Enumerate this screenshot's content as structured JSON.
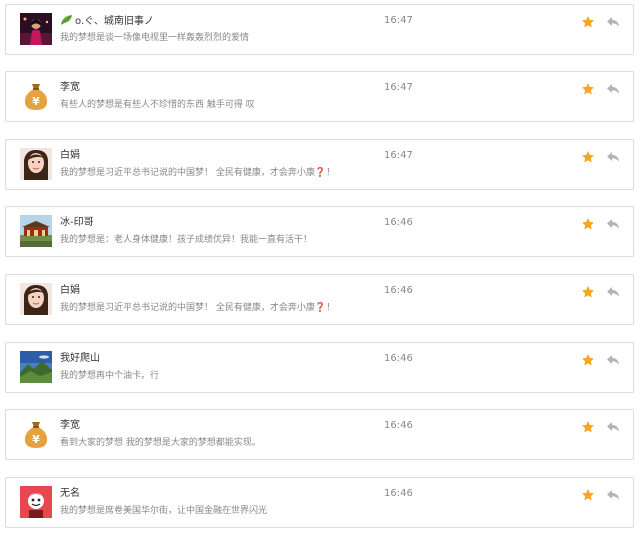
{
  "colors": {
    "star": "#f6a623",
    "reply": "#b4b4b4",
    "name": "#333333",
    "text": "#888888",
    "border": "#dcdcdc",
    "question_mark": "#d0241c"
  },
  "posts": [
    {
      "avatar": "night-portrait-avatar",
      "leaf_icon": true,
      "name": "o.ぐ、城南旧事ノ",
      "text": "我的梦想是谈一场像电视里一样轰轰烈烈的爱情",
      "suffix": "",
      "time": "16:47"
    },
    {
      "avatar": "money-bag-avatar",
      "leaf_icon": false,
      "name": "李宽",
      "text": "有些人的梦想是有些人不珍惜的东西 触手可得 叹",
      "suffix": "",
      "time": "16:47"
    },
    {
      "avatar": "girl-portrait-avatar",
      "leaf_icon": false,
      "name": "白娟",
      "text": "我的梦想是习近平总书记说的中国梦！ 全民有健康，才会奔小康",
      "suffix": "❓！",
      "time": "16:47"
    },
    {
      "avatar": "temple-landscape-avatar",
      "leaf_icon": false,
      "name": "冰-印哥",
      "text": "我的梦想是：老人身体健康！孩子成绩优异！我能一直有活干！",
      "suffix": "",
      "time": "16:46"
    },
    {
      "avatar": "girl-portrait-avatar",
      "leaf_icon": false,
      "name": "白娟",
      "text": "我的梦想是习近平总书记说的中国梦！ 全民有健康，才会奔小康",
      "suffix": "❓！",
      "time": "16:46"
    },
    {
      "avatar": "mountain-landscape-avatar",
      "leaf_icon": false,
      "name": "我好爬山",
      "text": "我的梦想再中个油卡。行",
      "suffix": "",
      "time": "16:46"
    },
    {
      "avatar": "money-bag-avatar",
      "leaf_icon": false,
      "name": "李宽",
      "text": "看到大家的梦想 我的梦想是大家的梦想都能实现。",
      "suffix": "",
      "time": "16:46"
    },
    {
      "avatar": "red-face-avatar",
      "leaf_icon": false,
      "name": "无名",
      "text": "我的梦想是席卷美国华尔街，让中国金融在世界闪光",
      "suffix": "",
      "time": "16:46"
    }
  ]
}
